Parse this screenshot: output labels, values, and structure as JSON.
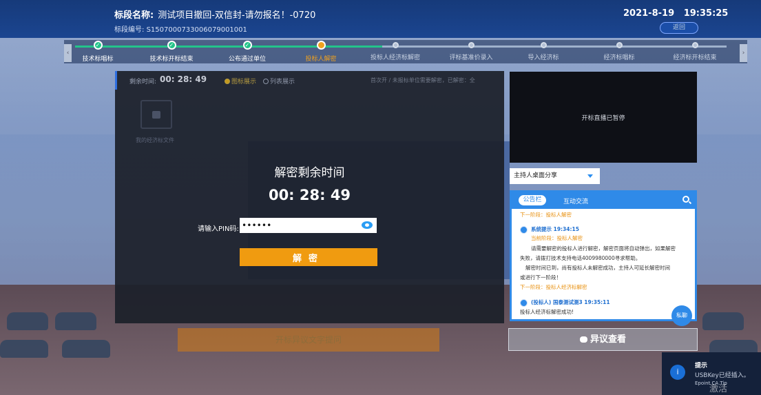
{
  "header": {
    "title_label": "标段名称:",
    "title_value": "测试项目撤回-双信封-请勿报名！-0720",
    "code_label": "标段编号:",
    "code_value": "S1507000733006079001001",
    "date": "2021-8-19",
    "time": "19:35:25",
    "back_label": "返回"
  },
  "progress": {
    "left_arrow": "‹",
    "right_arrow": "›",
    "steps": [
      {
        "label": "技术标唱标",
        "state": "done"
      },
      {
        "label": "技术标开标结束",
        "state": "done"
      },
      {
        "label": "公布通过单位",
        "state": "done"
      },
      {
        "label": "投标人解密",
        "state": "current"
      },
      {
        "label": "投标人经济标解密",
        "state": "todo"
      },
      {
        "label": "评标基准价录入",
        "state": "todo"
      },
      {
        "label": "导入经济标",
        "state": "todo"
      },
      {
        "label": "经济标唱标",
        "state": "todo"
      },
      {
        "label": "经济标开标结束",
        "state": "todo"
      }
    ]
  },
  "main": {
    "remaining_label": "剩余时间:",
    "remaining_value": "00: 28: 49",
    "radio_icon_label": "图标展示",
    "radio_list_label": "列表展示",
    "unlock_info": "首次开 / 未报标单位需要解密，已解密：全",
    "folder_label": "我的经济标文件",
    "decrypt_title": "解密剩余时间",
    "decrypt_time": "00: 28: 49",
    "pin_label": "请输入PIN码:",
    "pin_value": "••••••",
    "decrypt_button": "解密",
    "objection_text": "开标异议文字提问"
  },
  "side": {
    "video_message": "开标直播已暂停",
    "share_select": "主持人桌面分享",
    "chat_tab_notice": "公告栏",
    "chat_tab_interaction": "互动交流",
    "chat_lines": {
      "prev_stage": "下一阶段：投标人解密",
      "sys_title": "系统提示 19:34:15",
      "cur_stage": "当前阶段：投标人解密",
      "msg1": "请需要解密的投标人进行解密，解密页面将自动弹出，如果解密",
      "msg2": "失败，请拨打技术支持电话4009980000寻求帮助。",
      "msg3": "解密时间已到，尚有投标人未解密成功，主持人可延长解密时间",
      "msg4": "或进行下一阶段！",
      "next_stage": "下一阶段：投标人经济标解密",
      "bidder_title": "(投标人) 国泰测试测3 19:35:11",
      "bidder_msg": "投标人经济标解密成功!"
    },
    "private_button": "私聊",
    "view_objection": "异议查看"
  },
  "toast": {
    "icon": "i",
    "title": "提示",
    "message": "USBKey已经插入。",
    "sub": "Epoint CA Tip"
  },
  "watermark": "激活 Windows"
}
